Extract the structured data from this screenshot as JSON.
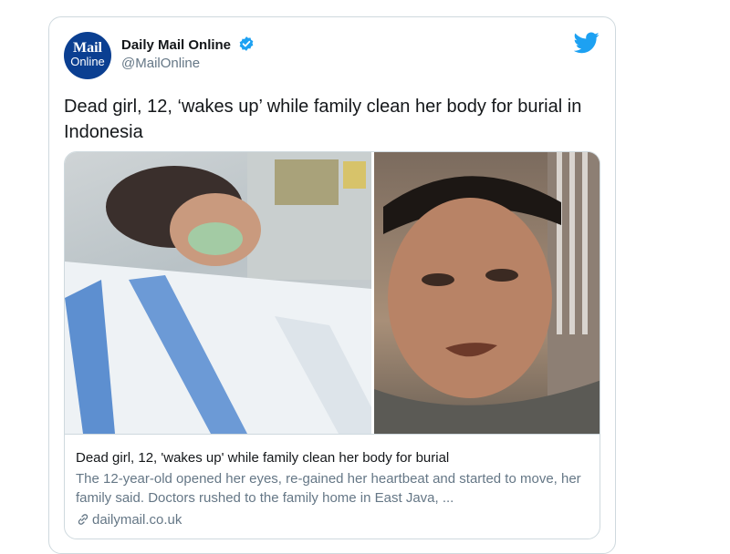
{
  "account": {
    "avatar_line1": "Mail",
    "avatar_line2": "Online",
    "name": "Daily Mail Online",
    "handle": "@MailOnline",
    "verified": true
  },
  "tweet": {
    "text": "Dead girl, 12, ‘wakes up’ while family clean her body for burial in Indonesia"
  },
  "card": {
    "title": "Dead girl, 12, 'wakes up' while family clean her body for burial",
    "description": "The 12-year-old opened her eyes, re-gained her heartbeat and started to move, her family said. Doctors rushed to the family home in East Java, ...",
    "domain": "dailymail.co.uk",
    "images": [
      "hospital-patient-photo",
      "man-portrait-photo"
    ]
  },
  "colors": {
    "twitter_blue": "#1da1f2",
    "avatar_bg": "#0b3f91",
    "muted_text": "#657786",
    "border": "#cfd9de"
  }
}
